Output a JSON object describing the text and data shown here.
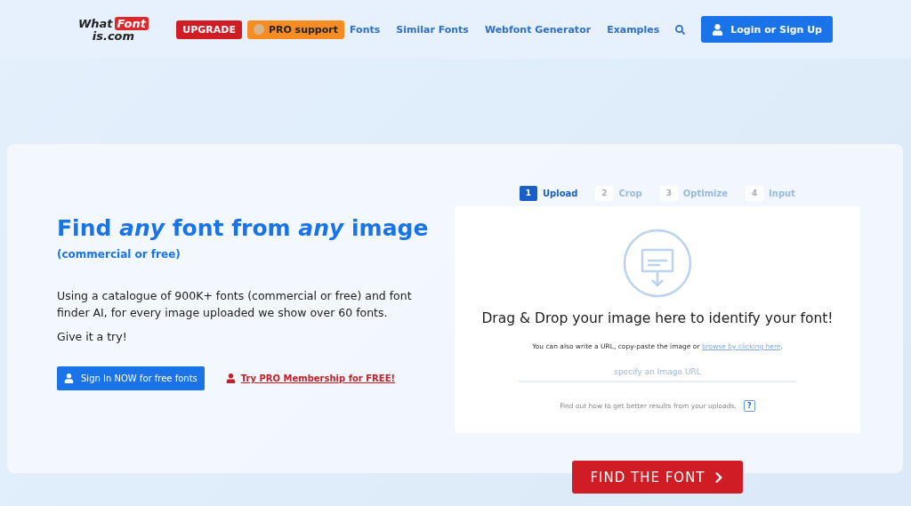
{
  "header": {
    "logo": {
      "word_1": "What",
      "word_2": "Font",
      "word_3": "is.com"
    },
    "nav": [
      {
        "label": "UPGRADE",
        "kind": "red"
      },
      {
        "label": "PRO support",
        "kind": "orange"
      },
      {
        "label": "Fonts",
        "kind": "link"
      },
      {
        "label": "Similar Fonts",
        "kind": "link"
      },
      {
        "label": "Webfont Generator",
        "kind": "link"
      },
      {
        "label": "Examples",
        "kind": "link"
      }
    ],
    "login_button": "Login or Sign Up"
  },
  "hero": {
    "title": "Find *any* font from *any* image",
    "subtitle": "(commercial or free)",
    "description": "Using a catalogue of 900K+ fonts (commercial or free) and font finder AI, for every image uploaded we show over 60 fonts.",
    "cta_text": "Give it a try!",
    "sign_in_button": "Sign In NOW for free fonts",
    "pro_link": "Try PRO Membership for FREE!"
  },
  "uploader": {
    "steps": [
      {
        "number": "1",
        "label": "Upload",
        "selected": true
      },
      {
        "number": "2",
        "label": "Crop",
        "selected": false
      },
      {
        "number": "3",
        "label": "Optimize",
        "selected": false
      },
      {
        "number": "4",
        "label": "Input",
        "selected": false
      }
    ],
    "drop_title": "Drag & Drop your image here to identify your font!",
    "hint": "You can also write a URL, copy-paste the image or",
    "hint_link": "browse by clicking here",
    "hint_end": ".",
    "url_field": {
      "placeholder": "specify an Image URL"
    },
    "help_text": "Find out how to get better results from your uploads.",
    "help_icon": "?"
  },
  "find_button": "FIND THE FONT"
}
